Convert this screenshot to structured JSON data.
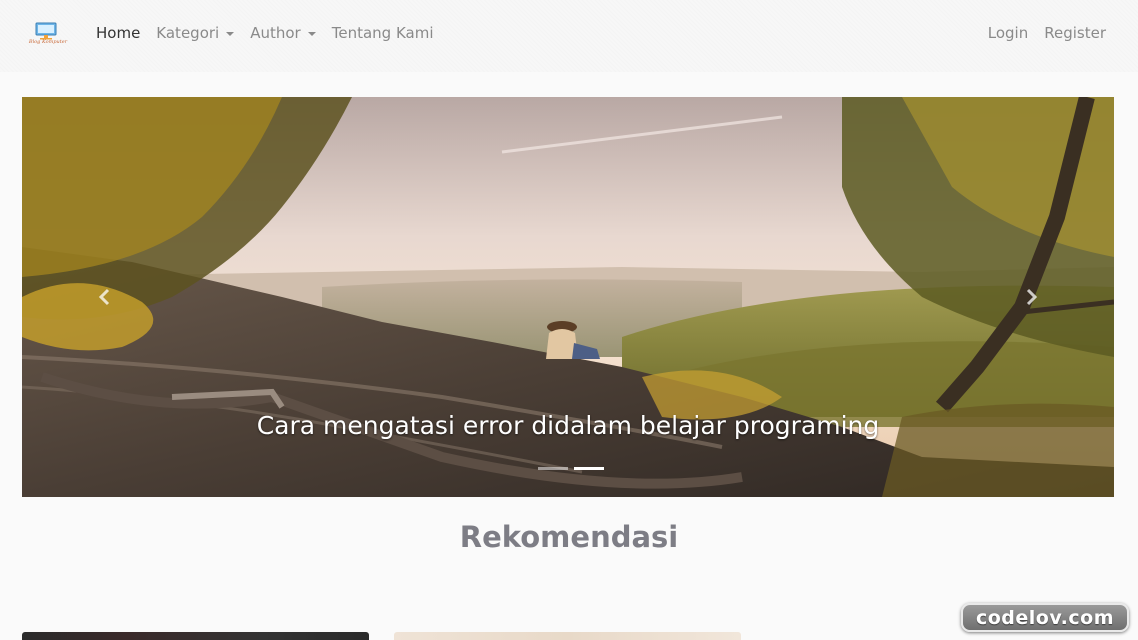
{
  "nav": {
    "brand_text": "Blog Komputer",
    "home": "Home",
    "kategori": "Kategori",
    "author": "Author",
    "tentang": "Tentang Kami",
    "login": "Login",
    "register": "Register"
  },
  "carousel": {
    "caption": "Cara mengatasi error didalam belajar programing",
    "slide_count": 2,
    "active_slide": 2
  },
  "recommend": {
    "title": "Rekomendasi"
  },
  "watermark": "codelov.com"
}
